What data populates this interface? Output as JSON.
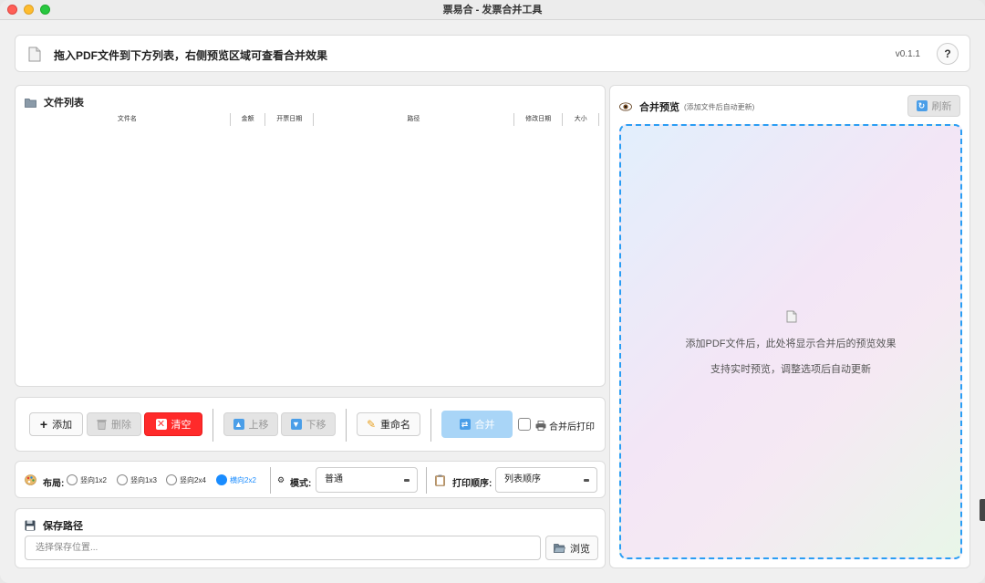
{
  "window": {
    "title": "票易合 - 发票合并工具"
  },
  "header": {
    "instruction": "拖入PDF文件到下方列表，右侧预览区域可查看合并效果",
    "version": "v0.1.1",
    "help_label": "?"
  },
  "file_list": {
    "title": "文件列表",
    "columns": [
      "文件名",
      "金额",
      "开票日期",
      "路径",
      "修改日期",
      "大小"
    ]
  },
  "toolbar": {
    "add": "添加",
    "delete": "删除",
    "clear": "清空",
    "move_up": "上移",
    "move_down": "下移",
    "rename": "重命名",
    "merge": "合并",
    "print_after_merge": "合并后打印"
  },
  "options": {
    "layout_label": "布局:",
    "layouts": [
      "竖向1x2",
      "竖向1x3",
      "竖向2x4",
      "横向2x2"
    ],
    "selected_layout": "横向2x2",
    "mode_label": "模式:",
    "mode_value": "普通",
    "print_order_label": "打印顺序:",
    "print_order_value": "列表顺序"
  },
  "save": {
    "title": "保存路径",
    "placeholder": "选择保存位置...",
    "browse": "浏览"
  },
  "preview": {
    "title": "合并预览",
    "subtitle": "(添加文件后自动更新)",
    "refresh": "刷新",
    "empty_line1": "添加PDF文件后，此处将显示合并后的预览效果",
    "empty_line2": "支持实时预览，调整选项后自动更新"
  },
  "colors": {
    "accent": "#1a8cff",
    "danger": "#ff2a2a",
    "merge_disabled": "#a9d5f7",
    "preview_border": "#2a9df4"
  },
  "icons": {
    "header": "document-icon",
    "file_list": "folder-icon",
    "add": "plus-icon",
    "delete": "trash-icon",
    "clear": "x-icon",
    "move_up": "arrow-up-icon",
    "move_down": "arrow-down-icon",
    "rename": "pencil-icon",
    "merge": "shuffle-icon",
    "print": "printer-icon",
    "layout": "palette-icon",
    "mode": "gear-icon",
    "print_order": "clipboard-icon",
    "save": "floppy-icon",
    "browse": "open-folder-icon",
    "preview": "eye-icon",
    "refresh": "refresh-icon"
  }
}
